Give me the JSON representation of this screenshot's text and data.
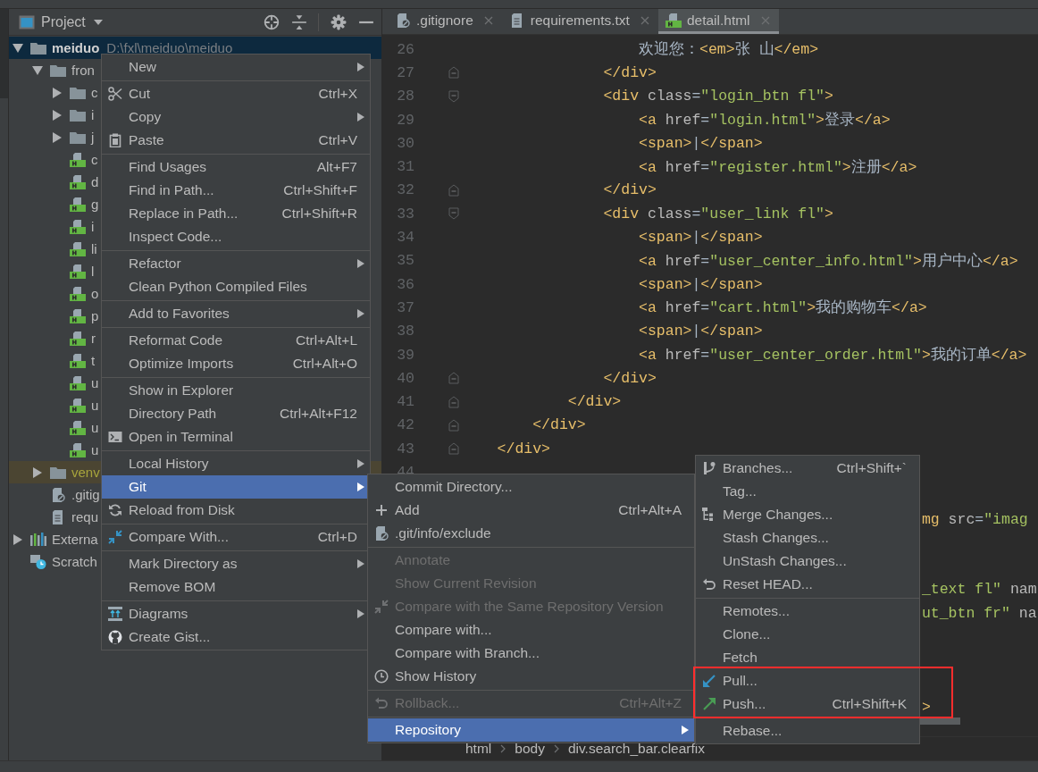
{
  "project_panel": {
    "title": "Project",
    "tree": [
      {
        "label": "meiduo",
        "detail": "D:\\fxl\\meiduo\\meiduo",
        "kind": "folder",
        "expanded": true,
        "selected": true,
        "children": [
          {
            "label": "fron",
            "kind": "folder",
            "expanded": true,
            "selected": false,
            "children": [
              {
                "label": "c",
                "kind": "folder",
                "expanded": false,
                "selected": false
              },
              {
                "label": "i",
                "kind": "folder",
                "expanded": false,
                "selected": false
              },
              {
                "label": "j",
                "kind": "folder",
                "expanded": false,
                "selected": false
              },
              {
                "label": "c",
                "kind": "html-file",
                "selected": false
              },
              {
                "label": "d",
                "kind": "html-file",
                "selected": false
              },
              {
                "label": "g",
                "kind": "html-file",
                "selected": false
              },
              {
                "label": "i",
                "kind": "html-file",
                "selected": false
              },
              {
                "label": "li",
                "kind": "html-file",
                "selected": false
              },
              {
                "label": "l",
                "kind": "html-file",
                "selected": false
              },
              {
                "label": "o",
                "kind": "html-file",
                "selected": false
              },
              {
                "label": "p",
                "kind": "html-file",
                "selected": false
              },
              {
                "label": "r",
                "kind": "html-file",
                "selected": false
              },
              {
                "label": "t",
                "kind": "html-file",
                "selected": false
              },
              {
                "label": "u",
                "kind": "html-file",
                "selected": false
              },
              {
                "label": "u",
                "kind": "html-file",
                "selected": false
              },
              {
                "label": "u",
                "kind": "html-file",
                "selected": false
              },
              {
                "label": "u",
                "kind": "html-file",
                "selected": false
              }
            ]
          },
          {
            "label": "venv",
            "kind": "excluded-folder",
            "expanded": false,
            "selected": false
          },
          {
            "label": ".gitig",
            "kind": "ignore-file",
            "selected": false
          },
          {
            "label": "requ",
            "kind": "text-file",
            "selected": false
          }
        ]
      },
      {
        "label": "Externa",
        "kind": "library",
        "expanded": false,
        "selected": false
      },
      {
        "label": "Scratch",
        "kind": "scratch",
        "selected": false
      }
    ]
  },
  "editor": {
    "tabs": [
      {
        "label": ".gitignore",
        "kind": "ignore-file",
        "selected": false
      },
      {
        "label": "requirements.txt",
        "kind": "text-file",
        "selected": false
      },
      {
        "label": "detail.html",
        "kind": "html-file",
        "selected": true
      }
    ],
    "lines": [
      {
        "number": "26",
        "kind": "plain",
        "code": [
          {
            "kind": "text",
            "text": "                    欢迎您："
          },
          {
            "kind": "tag",
            "text": "<em>"
          },
          {
            "kind": "text",
            "text": "张 山"
          },
          {
            "kind": "tag",
            "text": "</em>"
          }
        ]
      },
      {
        "number": "27",
        "kind": "fold-end",
        "code": [
          {
            "kind": "tag",
            "text": "                </div>"
          }
        ]
      },
      {
        "number": "28",
        "kind": "fold-start",
        "code": [
          {
            "kind": "tag",
            "text": "                <div"
          },
          {
            "kind": "attr",
            "text": " class"
          },
          {
            "kind": "text",
            "text": "="
          },
          {
            "kind": "value",
            "text": "\"login_btn fl\""
          },
          {
            "kind": "tag",
            "text": ">"
          }
        ]
      },
      {
        "number": "29",
        "kind": "plain",
        "code": [
          {
            "kind": "tag",
            "text": "                    <a"
          },
          {
            "kind": "attr",
            "text": " href"
          },
          {
            "kind": "text",
            "text": "="
          },
          {
            "kind": "value",
            "text": "\"login.html\""
          },
          {
            "kind": "tag",
            "text": ">"
          },
          {
            "kind": "text",
            "text": "登录"
          },
          {
            "kind": "tag",
            "text": "</a>"
          }
        ]
      },
      {
        "number": "30",
        "kind": "plain",
        "code": [
          {
            "kind": "tag",
            "text": "                    <span>"
          },
          {
            "kind": "text",
            "text": "|"
          },
          {
            "kind": "tag",
            "text": "</span>"
          }
        ]
      },
      {
        "number": "31",
        "kind": "plain",
        "code": [
          {
            "kind": "tag",
            "text": "                    <a"
          },
          {
            "kind": "attr",
            "text": " href"
          },
          {
            "kind": "text",
            "text": "="
          },
          {
            "kind": "value",
            "text": "\"register.html\""
          },
          {
            "kind": "tag",
            "text": ">"
          },
          {
            "kind": "text",
            "text": "注册"
          },
          {
            "kind": "tag",
            "text": "</a>"
          }
        ]
      },
      {
        "number": "32",
        "kind": "fold-end",
        "code": [
          {
            "kind": "tag",
            "text": "                </div>"
          }
        ]
      },
      {
        "number": "33",
        "kind": "fold-start",
        "code": [
          {
            "kind": "tag",
            "text": "                <div"
          },
          {
            "kind": "attr",
            "text": " class"
          },
          {
            "kind": "text",
            "text": "="
          },
          {
            "kind": "value",
            "text": "\"user_link fl\""
          },
          {
            "kind": "tag",
            "text": ">"
          }
        ]
      },
      {
        "number": "34",
        "kind": "plain",
        "code": [
          {
            "kind": "tag",
            "text": "                    <span>"
          },
          {
            "kind": "text",
            "text": "|"
          },
          {
            "kind": "tag",
            "text": "</span>"
          }
        ]
      },
      {
        "number": "35",
        "kind": "plain",
        "code": [
          {
            "kind": "tag",
            "text": "                    <a"
          },
          {
            "kind": "attr",
            "text": " href"
          },
          {
            "kind": "text",
            "text": "="
          },
          {
            "kind": "value",
            "text": "\"user_center_info.html\""
          },
          {
            "kind": "tag",
            "text": ">"
          },
          {
            "kind": "text",
            "text": "用户中心"
          },
          {
            "kind": "tag",
            "text": "</a>"
          }
        ]
      },
      {
        "number": "36",
        "kind": "plain",
        "code": [
          {
            "kind": "tag",
            "text": "                    <span>"
          },
          {
            "kind": "text",
            "text": "|"
          },
          {
            "kind": "tag",
            "text": "</span>"
          }
        ]
      },
      {
        "number": "37",
        "kind": "plain",
        "code": [
          {
            "kind": "tag",
            "text": "                    <a"
          },
          {
            "kind": "attr",
            "text": " href"
          },
          {
            "kind": "text",
            "text": "="
          },
          {
            "kind": "value",
            "text": "\"cart.html\""
          },
          {
            "kind": "tag",
            "text": ">"
          },
          {
            "kind": "text",
            "text": "我的购物车"
          },
          {
            "kind": "tag",
            "text": "</a>"
          }
        ]
      },
      {
        "number": "38",
        "kind": "plain",
        "code": [
          {
            "kind": "tag",
            "text": "                    <span>"
          },
          {
            "kind": "text",
            "text": "|"
          },
          {
            "kind": "tag",
            "text": "</span>"
          }
        ]
      },
      {
        "number": "39",
        "kind": "plain",
        "code": [
          {
            "kind": "tag",
            "text": "                    <a"
          },
          {
            "kind": "attr",
            "text": " href"
          },
          {
            "kind": "text",
            "text": "="
          },
          {
            "kind": "value",
            "text": "\"user_center_order.html\""
          },
          {
            "kind": "tag",
            "text": ">"
          },
          {
            "kind": "text",
            "text": "我的订单"
          },
          {
            "kind": "tag",
            "text": "</a>"
          }
        ]
      },
      {
        "number": "40",
        "kind": "fold-end",
        "code": [
          {
            "kind": "tag",
            "text": "                </div>"
          }
        ]
      },
      {
        "number": "41",
        "kind": "fold-end",
        "code": [
          {
            "kind": "tag",
            "text": "            </div>"
          }
        ]
      },
      {
        "number": "42",
        "kind": "fold-end",
        "code": [
          {
            "kind": "tag",
            "text": "        </div>"
          }
        ]
      },
      {
        "number": "43",
        "kind": "fold-end",
        "code": [
          {
            "kind": "tag",
            "text": "    </div>"
          }
        ]
      },
      {
        "number": "44",
        "kind": "plain"
      },
      {
        "kind": "plain"
      },
      {
        "kind": "plain",
        "code": [
          {
            "kind": "tag",
            "text": "                                                    mg"
          },
          {
            "kind": "attr",
            "text": " src"
          },
          {
            "kind": "text",
            "text": "="
          },
          {
            "kind": "value",
            "text": "\"imag"
          }
        ]
      },
      {
        "kind": "plain"
      },
      {
        "kind": "plain"
      },
      {
        "kind": "plain",
        "code": [
          {
            "kind": "value",
            "text": "                                                    _text fl\""
          },
          {
            "kind": "attr",
            "text": " nam"
          }
        ]
      },
      {
        "kind": "plain",
        "code": [
          {
            "kind": "value",
            "text": "                                                    ut_btn fr\""
          },
          {
            "kind": "attr",
            "text": " na"
          }
        ]
      },
      {
        "kind": "plain"
      },
      {
        "kind": "plain"
      },
      {
        "kind": "plain"
      },
      {
        "kind": "plain",
        "code": [
          {
            "kind": "tag",
            "text": "                                                    >"
          }
        ]
      }
    ],
    "breadcrumb": [
      "html",
      "body",
      "div.search_bar.clearfix"
    ]
  },
  "context_menu": {
    "groups": [
      {
        "items": [
          {
            "label": "New",
            "kind": "plain",
            "submenu": true,
            "selected": false
          }
        ]
      },
      {
        "items": [
          {
            "label": "Cut",
            "kind": "cut",
            "shortcut": "Ctrl+X",
            "submenu": false,
            "selected": false
          },
          {
            "label": "Copy",
            "kind": "plain",
            "submenu": true,
            "selected": false
          },
          {
            "label": "Paste",
            "kind": "paste",
            "shortcut": "Ctrl+V",
            "submenu": false,
            "selected": false
          }
        ]
      },
      {
        "items": [
          {
            "label": "Find Usages",
            "kind": "plain",
            "shortcut": "Alt+F7",
            "submenu": false,
            "selected": false
          },
          {
            "label": "Find in Path...",
            "kind": "plain",
            "shortcut": "Ctrl+Shift+F",
            "submenu": false,
            "selected": false
          },
          {
            "label": "Replace in Path...",
            "kind": "plain",
            "shortcut": "Ctrl+Shift+R",
            "submenu": false,
            "selected": false
          },
          {
            "label": "Inspect Code...",
            "kind": "plain",
            "submenu": false,
            "selected": false
          }
        ]
      },
      {
        "items": [
          {
            "label": "Refactor",
            "kind": "plain",
            "submenu": true,
            "selected": false
          },
          {
            "label": "Clean Python Compiled Files",
            "kind": "plain",
            "submenu": false,
            "selected": false
          }
        ]
      },
      {
        "items": [
          {
            "label": "Add to Favorites",
            "kind": "plain",
            "submenu": true,
            "selected": false
          }
        ]
      },
      {
        "items": [
          {
            "label": "Reformat Code",
            "kind": "plain",
            "shortcut": "Ctrl+Alt+L",
            "submenu": false,
            "selected": false
          },
          {
            "label": "Optimize Imports",
            "kind": "plain",
            "shortcut": "Ctrl+Alt+O",
            "submenu": false,
            "selected": false
          }
        ]
      },
      {
        "items": [
          {
            "label": "Show in Explorer",
            "kind": "plain",
            "submenu": false,
            "selected": false
          },
          {
            "label": "Directory Path",
            "kind": "plain",
            "shortcut": "Ctrl+Alt+F12",
            "submenu": false,
            "selected": false
          },
          {
            "label": "Open in Terminal",
            "kind": "terminal",
            "submenu": false,
            "selected": false
          }
        ]
      },
      {
        "items": [
          {
            "label": "Local History",
            "kind": "plain",
            "submenu": true,
            "selected": false
          },
          {
            "label": "Git",
            "kind": "plain",
            "submenu": true,
            "selected": true
          },
          {
            "label": "Reload from Disk",
            "kind": "reload",
            "submenu": false,
            "selected": false
          }
        ]
      },
      {
        "items": [
          {
            "label": "Compare With...",
            "kind": "compare",
            "shortcut": "Ctrl+D",
            "submenu": false,
            "selected": false
          }
        ]
      },
      {
        "items": [
          {
            "label": "Mark Directory as",
            "kind": "plain",
            "submenu": true,
            "selected": false
          },
          {
            "label": "Remove BOM",
            "kind": "plain",
            "submenu": false,
            "selected": false
          }
        ]
      },
      {
        "items": [
          {
            "label": "Diagrams",
            "kind": "diagram",
            "submenu": true,
            "selected": false
          },
          {
            "label": "Create Gist...",
            "kind": "gist",
            "submenu": false,
            "selected": false
          }
        ]
      }
    ]
  },
  "git_menu": {
    "groups": [
      {
        "items": [
          {
            "label": "Commit Directory...",
            "kind": "plain",
            "submenu": false,
            "selected": false,
            "disabled": false
          },
          {
            "label": "Add",
            "kind": "add",
            "shortcut": "Ctrl+Alt+A",
            "submenu": false,
            "selected": false,
            "disabled": false
          },
          {
            "label": ".git/info/exclude",
            "kind": "ignore-file",
            "submenu": false,
            "selected": false,
            "disabled": false
          }
        ]
      },
      {
        "items": [
          {
            "label": "Annotate",
            "kind": "plain",
            "submenu": false,
            "selected": false,
            "disabled": true
          },
          {
            "label": "Show Current Revision",
            "kind": "plain",
            "submenu": false,
            "selected": false,
            "disabled": true
          },
          {
            "label": "Compare with the Same Repository Version",
            "kind": "compare",
            "submenu": false,
            "selected": false,
            "disabled": true
          },
          {
            "label": "Compare with...",
            "kind": "plain",
            "submenu": false,
            "selected": false,
            "disabled": false
          },
          {
            "label": "Compare with Branch...",
            "kind": "plain",
            "submenu": false,
            "selected": false,
            "disabled": false
          },
          {
            "label": "Show History",
            "kind": "history",
            "submenu": false,
            "selected": false,
            "disabled": false
          }
        ]
      },
      {
        "items": [
          {
            "label": "Rollback...",
            "kind": "undo",
            "shortcut": "Ctrl+Alt+Z",
            "submenu": false,
            "selected": false,
            "disabled": true
          }
        ]
      },
      {
        "items": [
          {
            "label": "Repository",
            "kind": "plain",
            "submenu": true,
            "selected": true,
            "disabled": false
          }
        ]
      }
    ]
  },
  "repository_menu": {
    "groups": [
      {
        "highlighted": false,
        "items": [
          {
            "label": "Branches...",
            "kind": "branch",
            "shortcut": "Ctrl+Shift+`",
            "submenu": false,
            "selected": false
          },
          {
            "label": "Tag...",
            "kind": "plain",
            "submenu": false,
            "selected": false
          },
          {
            "label": "Merge Changes...",
            "kind": "merge",
            "submenu": false,
            "selected": false
          },
          {
            "label": "Stash Changes...",
            "kind": "plain",
            "submenu": false,
            "selected": false
          },
          {
            "label": "UnStash Changes...",
            "kind": "plain",
            "submenu": false,
            "selected": false
          },
          {
            "label": "Reset HEAD...",
            "kind": "undo",
            "submenu": false,
            "selected": false
          }
        ]
      },
      {
        "highlighted": false,
        "items": [
          {
            "label": "Remotes...",
            "kind": "plain",
            "submenu": false,
            "selected": false
          },
          {
            "label": "Clone...",
            "kind": "plain",
            "submenu": false,
            "selected": false
          },
          {
            "label": "Fetch",
            "kind": "plain",
            "submenu": false,
            "selected": false
          }
        ]
      },
      {
        "highlighted": true,
        "items": [
          {
            "label": "Pull...",
            "kind": "pull",
            "submenu": false,
            "selected": false
          },
          {
            "label": "Push...",
            "kind": "push",
            "shortcut": "Ctrl+Shift+K",
            "submenu": false,
            "selected": false
          }
        ]
      },
      {
        "highlighted": false,
        "items": [
          {
            "label": "Rebase...",
            "kind": "plain",
            "submenu": false,
            "selected": false
          }
        ]
      }
    ]
  }
}
